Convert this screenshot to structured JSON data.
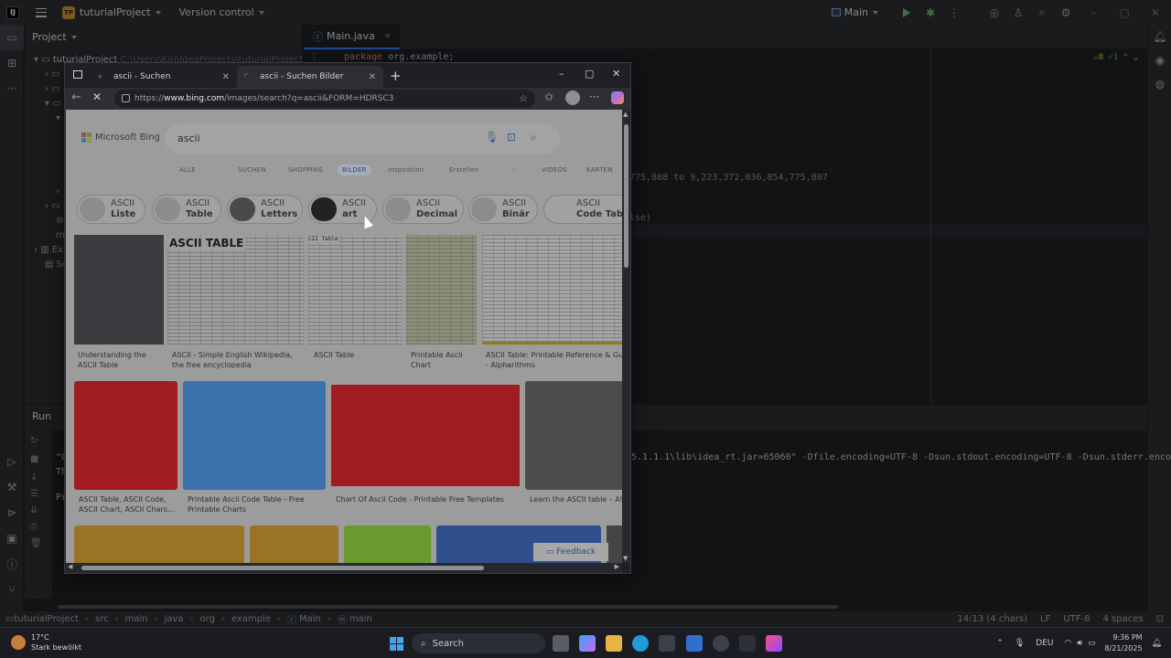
{
  "ide": {
    "logo": "IJ",
    "project_badge": "TP",
    "project_name": "tuturialProject",
    "vcs": "Version control",
    "run_config": "Main",
    "project_panel_title": "Project",
    "tree": {
      "root": "tuturialProject",
      "root_path": "C:\\Users\\Kiri\\IdeaProjects\\tuturialProject",
      "external": "Ex",
      "scratches": "Sc"
    },
    "tab": {
      "label": "Main.java",
      "close": "×"
    },
    "inspections": {
      "warnings": "8",
      "ok": "1"
    },
    "code": {
      "line1_num": "1",
      "keyword_package": "package",
      "package_name": "org.example;",
      "frag_range": "775,808 to 9,223,372,036,854,775,807",
      "frag_else": "lse)"
    },
    "run_panel": {
      "title": "Run",
      "console_frag1": "\"C",
      "console_frag2": "Th",
      "console_frag3": "Pr",
      "console_long": "5.1.1.1\\lib\\idea_rt.jar=65060\" -Dfile.encoding=UTF-8 -Dsun.stdout.encoding=UTF-8 -Dsun.stderr.encoding=UTF"
    },
    "breadcrumbs": [
      "tuturialProject",
      "src",
      "main",
      "java",
      "org",
      "example",
      "Main",
      "main"
    ],
    "status": {
      "position": "14:13 (4 chars)",
      "line_sep": "LF",
      "encoding": "UTF-8",
      "indent": "4 spaces"
    }
  },
  "browser": {
    "tabs": [
      {
        "label": "ascii - Suchen",
        "active": false
      },
      {
        "label": "ascii - Suchen Bilder",
        "active": true
      }
    ],
    "new_tab": "+",
    "url_prefix": "https://",
    "url_host": "www.bing.com",
    "url_rest": "/images/search?q=ascii&FORM=HDRSC3",
    "bing": {
      "brand": "Microsoft Bing",
      "query": "ascii",
      "nav": [
        "ALLE",
        "SUCHEN",
        "SHOPPING",
        "BILDER",
        "Inspiration",
        "Erstellen",
        "···",
        "VIDEOS",
        "KARTEN"
      ],
      "chips": [
        {
          "top": "ASCII",
          "bottom": "Liste"
        },
        {
          "top": "ASCII",
          "bottom": "Table"
        },
        {
          "top": "ASCII",
          "bottom": "Letters"
        },
        {
          "top": "ASCII",
          "bottom": "art"
        },
        {
          "top": "ASCII",
          "bottom": "Decimal"
        },
        {
          "top": "ASCII",
          "bottom": "Binär"
        },
        {
          "top": "ASCII",
          "bottom": "Code Table"
        }
      ],
      "row1_captions": [
        [
          "Understanding the",
          "ASCII Table"
        ],
        [
          "ASCII - Simple English Wikipedia,",
          "the free encyclopedia"
        ],
        [
          "ASCII Table",
          ""
        ],
        [
          "Printable Ascii",
          "Chart"
        ],
        [
          "ASCII Table: Printable Reference & Gui",
          "- Alpharithms"
        ]
      ],
      "row2_captions": [
        [
          "ASCII Table, ASCII Code,",
          "ASCII Chart, ASCII Chars..."
        ],
        [
          "Printable Ascii Code Table - Free",
          "Printable Charts"
        ],
        [
          "Chart Of Ascii Code - Printable Free Templates",
          ""
        ],
        [
          "Learn the ASCII table – AS",
          ""
        ]
      ],
      "tile_texts": {
        "ascii_table": "ASCII TABLE",
        "ascii_table_small": "CII Table"
      },
      "feedback": "Feedback"
    },
    "colors": {
      "red_tile": "#a01c20",
      "blue_tile": "#3a72ab",
      "green_tile": "#6a9a2f",
      "gold_tile": "#9a7426"
    }
  },
  "taskbar": {
    "weather_temp": "17°C",
    "weather_desc": "Stark bewölkt",
    "search": "Search",
    "lang": "DEU",
    "time": "9:36 PM",
    "date": "8/21/2025"
  }
}
